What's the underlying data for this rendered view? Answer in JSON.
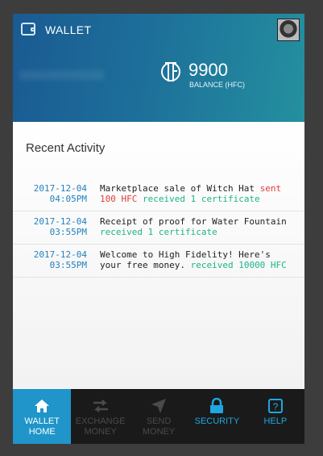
{
  "header": {
    "title": "WALLET",
    "balance_value": "9900",
    "balance_label": "BALANCE (HFC)"
  },
  "recent": {
    "title": "Recent Activity",
    "items": [
      {
        "date": "2017-12-04",
        "time": "04:05PM",
        "text": "Marketplace sale of Witch Hat",
        "sent": "sent 100 HFC",
        "received": "received 1 certificate"
      },
      {
        "date": "2017-12-04",
        "time": "03:55PM",
        "text": "Receipt of proof for Water Fountain",
        "received": "received 1 certificate"
      },
      {
        "date": "2017-12-04",
        "time": "03:55PM",
        "text": "Welcome to High Fidelity! Here's your free money.",
        "received": "received 10000 HFC"
      }
    ]
  },
  "nav": {
    "items": [
      {
        "line1": "WALLET",
        "line2": "HOME",
        "icon": "home-icon",
        "state": "active"
      },
      {
        "line1": "EXCHANGE",
        "line2": "MONEY",
        "icon": "exchange-icon",
        "state": "disabled"
      },
      {
        "line1": "SEND",
        "line2": "MONEY",
        "icon": "send-icon",
        "state": "disabled"
      },
      {
        "line1": "SECURITY",
        "line2": "",
        "icon": "lock-icon",
        "state": "enabled"
      },
      {
        "line1": "HELP",
        "line2": "",
        "icon": "help-icon",
        "state": "enabled"
      }
    ]
  },
  "colors": {
    "accent": "#1f95c9",
    "sent": "#e23b3b",
    "received": "#1fb38a",
    "timestamp": "#2380bf"
  }
}
